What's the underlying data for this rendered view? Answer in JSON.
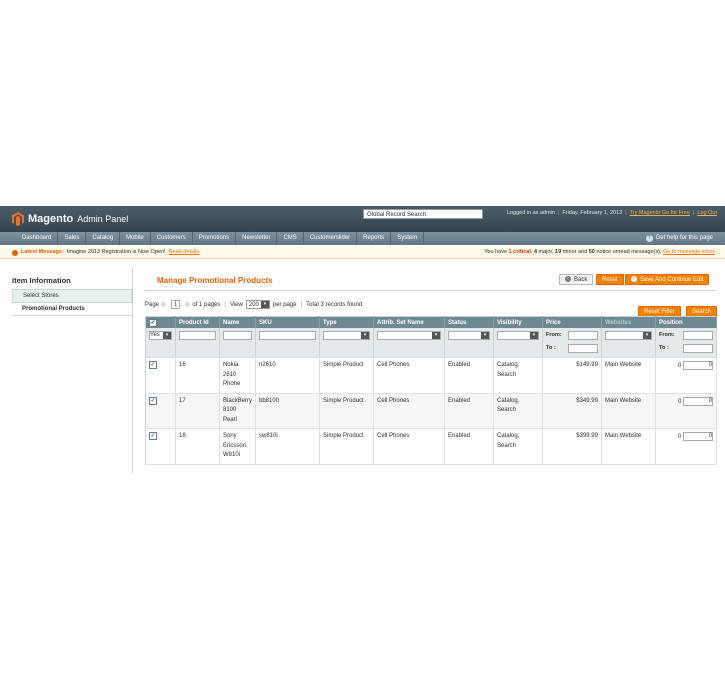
{
  "header": {
    "logo_text": "Magento",
    "logo_sub": "Admin Panel",
    "global_search": "Global Record Search",
    "logged_in": "Logged in as admin",
    "date": "Friday, February 1, 2013",
    "try_link": "Try Magento Go for Free",
    "logout": "Log Out",
    "sep": "|"
  },
  "nav": {
    "items": [
      "Dashboard",
      "Sales",
      "Catalog",
      "Mobile",
      "Customers",
      "Promotions",
      "Newsletter",
      "CMS",
      "Customerslider",
      "Reports",
      "System"
    ],
    "help": "Get help for this page"
  },
  "message": {
    "label": "Latest Message:",
    "text": "Imagine 2013 Registration is Now Open!",
    "read": "Read details",
    "prefix": "You have",
    "critical_count": "1 critical",
    "rest_a": ",",
    "major": "4",
    "major_text": "major,",
    "minor": "19",
    "minor_text": "minor and",
    "notice": "50",
    "notice_text": "notice unread message(s).",
    "inbox": "Go to message inbox"
  },
  "sidebar": {
    "title": "Item Information",
    "items": [
      "Select Stores",
      "Promotional Products"
    ]
  },
  "main": {
    "title": "Manage Promotional Products",
    "back": "Back",
    "reset": "Reset",
    "save_continue": "Save And Continue Edit",
    "reset_filter": "Reset Filter",
    "search": "Search"
  },
  "pager": {
    "page_label": "Page",
    "page": "1",
    "of_pages": "of 1 pages",
    "view_label": "View",
    "per_page": "200",
    "per_page_label": "per page",
    "records": "Total 3 records found",
    "sep": "|"
  },
  "grid": {
    "columns": [
      "Product Id",
      "Name",
      "SKU",
      "Type",
      "Attrib. Set Name",
      "Status",
      "Visibility",
      "Price",
      "Websites",
      "Position"
    ],
    "filter_yes": "Yes",
    "from": "From:",
    "to": "To :",
    "rows": [
      {
        "id": "16",
        "name": "Nokia 2610 Phone",
        "sku": "n2610",
        "type": "Simple Product",
        "attr": "Cell Phones",
        "status": "Enabled",
        "visibility": "Catalog, Search",
        "price": "$149.99",
        "websites": "Main Website",
        "position": "0",
        "pos_input": "0"
      },
      {
        "id": "17",
        "name": "BlackBerry 8100 Pearl",
        "sku": "bb8100",
        "type": "Simple Product",
        "attr": "Cell Phones",
        "status": "Enabled",
        "visibility": "Catalog, Search",
        "price": "$349.99",
        "websites": "Main Website",
        "position": "0",
        "pos_input": "0"
      },
      {
        "id": "18",
        "name": "Sony Ericsson W810i",
        "sku": "sw810i",
        "type": "Simple Product",
        "attr": "Cell Phones",
        "status": "Enabled",
        "visibility": "Catalog, Search",
        "price": "$399.99",
        "websites": "Main Website",
        "position": "0",
        "pos_input": "0"
      }
    ]
  },
  "colors": {
    "accent": "#eb5e00",
    "header": "#3b4d5a",
    "nav": "#6f8492",
    "grid_head": "#6f8992"
  }
}
